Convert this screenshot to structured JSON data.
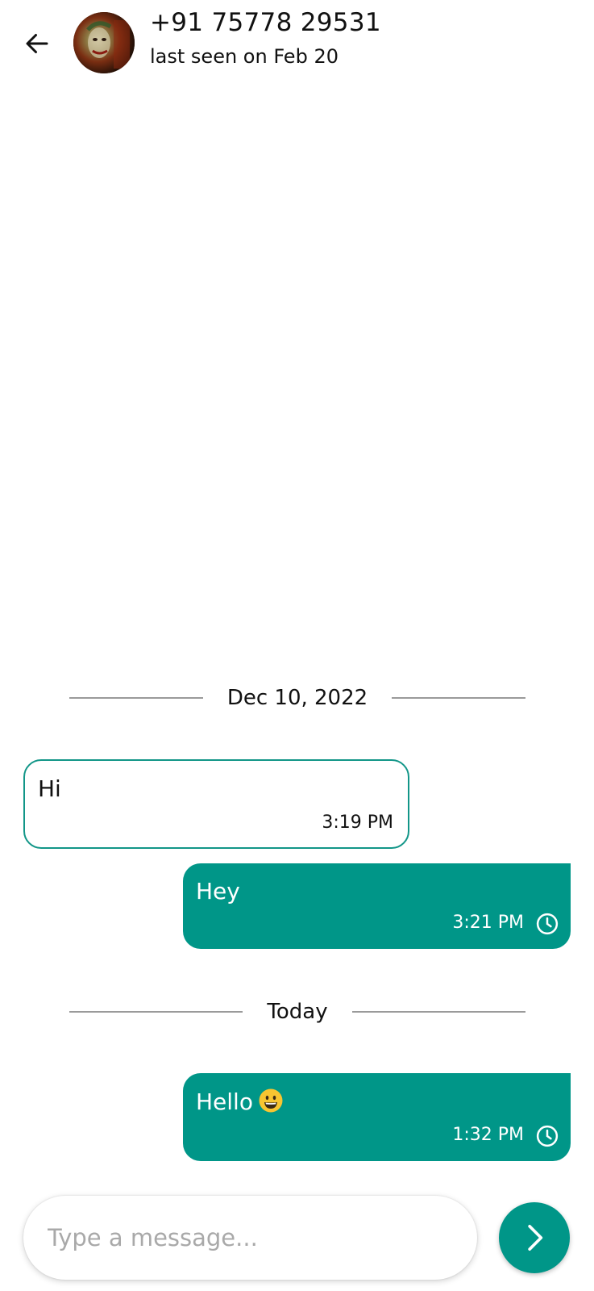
{
  "header": {
    "contact_name": "+91 75778 29531",
    "status": "last seen on Feb 20",
    "back_icon": "arrow-left-icon",
    "avatar_icon": "contact-avatar"
  },
  "dividers": [
    {
      "label": "Dec 10, 2022"
    },
    {
      "label": "Today"
    }
  ],
  "messages": [
    {
      "direction": "incoming",
      "text": "Hi",
      "time": "3:19 PM"
    },
    {
      "direction": "outgoing",
      "text": "Hey",
      "time": "3:21 PM",
      "status_icon": "clock-icon"
    },
    {
      "direction": "outgoing",
      "text": "Hello",
      "emoji": "grinning-face",
      "time": "1:32 PM",
      "status_icon": "clock-icon"
    }
  ],
  "composer": {
    "placeholder": "Type a message...",
    "value": "",
    "send_icon": "chevron-right-icon"
  },
  "colors": {
    "accent": "#009688",
    "incoming_border": "#129688",
    "divider_line": "#9a9a9a",
    "placeholder": "#a9a9a9"
  }
}
